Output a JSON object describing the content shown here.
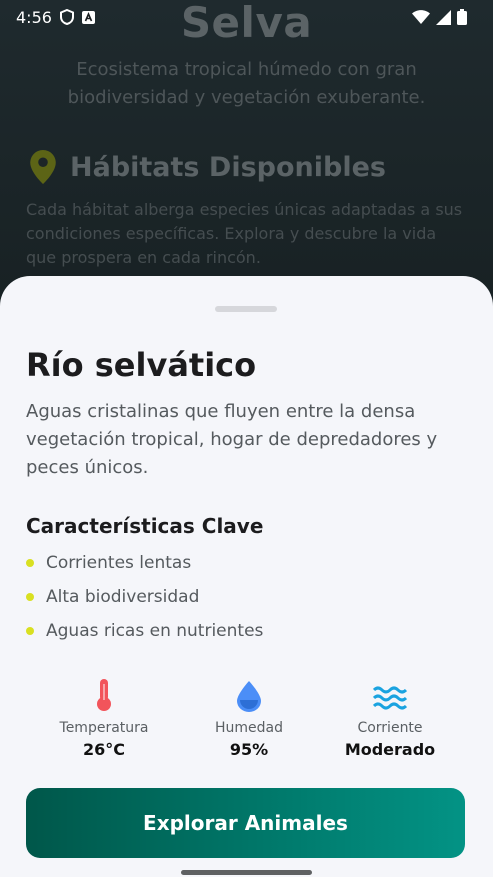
{
  "status_bar": {
    "time": "4:56"
  },
  "background": {
    "title": "Selva",
    "subtitle": "Ecosistema tropical húmedo con gran biodiversidad y vegetación exuberante.",
    "section_title": "Hábitats Disponibles",
    "section_desc": "Cada hábitat alberga especies únicas adaptadas a sus condiciones específicas. Explora y descubre la vida que prospera en cada rincón."
  },
  "sheet": {
    "title": "Río selvático",
    "description": "Aguas cristalinas que fluyen entre la densa vegetación tropical, hogar de depredadores y peces únicos.",
    "features_title": "Características Clave",
    "features": [
      "Corrientes lentas",
      "Alta biodiversidad",
      "Aguas ricas en nutrientes"
    ],
    "stats": {
      "temperature": {
        "label": "Temperatura",
        "value": "26°C",
        "icon": "thermometer-icon",
        "color": "#f2545b"
      },
      "humidity": {
        "label": "Humedad",
        "value": "95%",
        "icon": "water-drop-icon",
        "color": "#4b8ef7"
      },
      "current": {
        "label": "Corriente",
        "value": "Moderado",
        "icon": "waves-icon",
        "color": "#1aa3e0"
      }
    },
    "button_label": "Explorar Animales"
  },
  "colors": {
    "accent_green": "#00786a",
    "bullet": "#d9e021",
    "pin": "#8f9a1c"
  }
}
